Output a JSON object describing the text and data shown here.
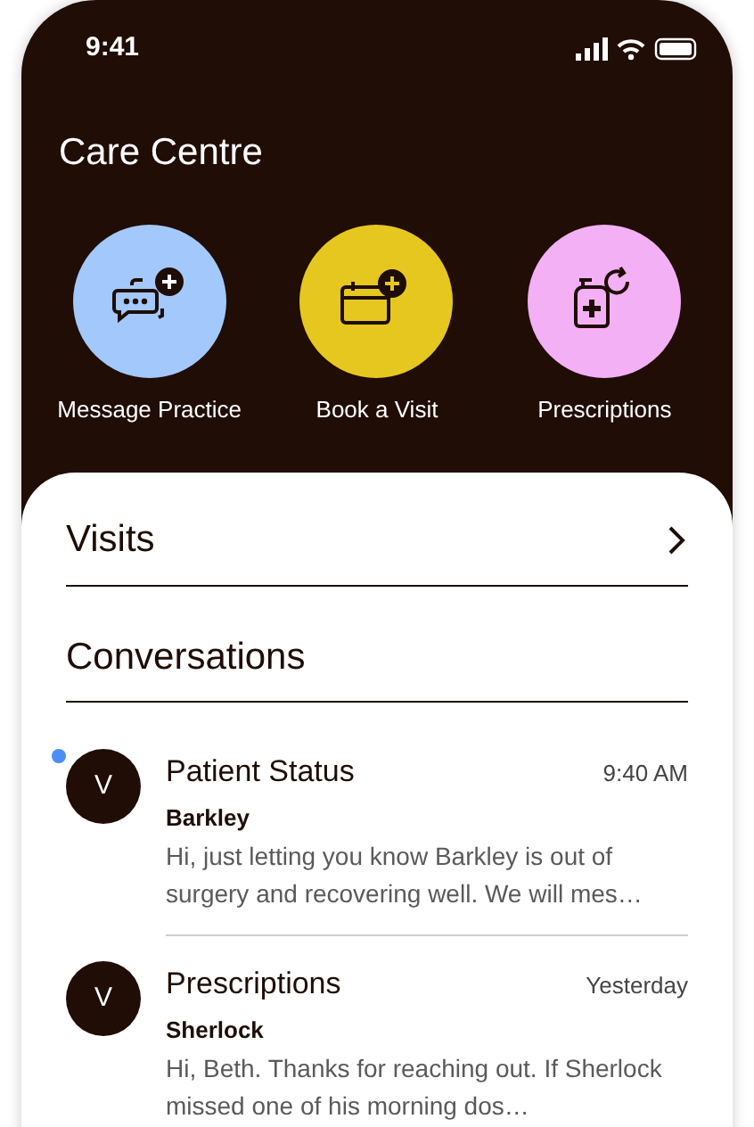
{
  "status_bar": {
    "time": "9:41"
  },
  "header": {
    "title": "Care Centre"
  },
  "actions": [
    {
      "kind": "message",
      "label": "Message Practice",
      "color": "#a3c8fb"
    },
    {
      "kind": "calendar",
      "label": "Book a Visit",
      "color": "#e6c71f"
    },
    {
      "kind": "prescription",
      "label": "Prescriptions",
      "color": "#f3b0f5"
    }
  ],
  "visits": {
    "title": "Visits"
  },
  "conversations": {
    "title": "Conversations",
    "items": [
      {
        "avatar": "V",
        "title": "Patient Status",
        "time": "9:40 AM",
        "pet": "Barkley",
        "preview": "Hi, just letting you know Barkley is out of surgery and recovering well.  We will mes…",
        "unread": true
      },
      {
        "avatar": "V",
        "title": "Prescriptions",
        "time": "Yesterday",
        "pet": "Sherlock",
        "preview": "Hi, Beth. Thanks for reaching out. If Sherlock missed one of his morning dos…",
        "unread": false
      }
    ]
  }
}
